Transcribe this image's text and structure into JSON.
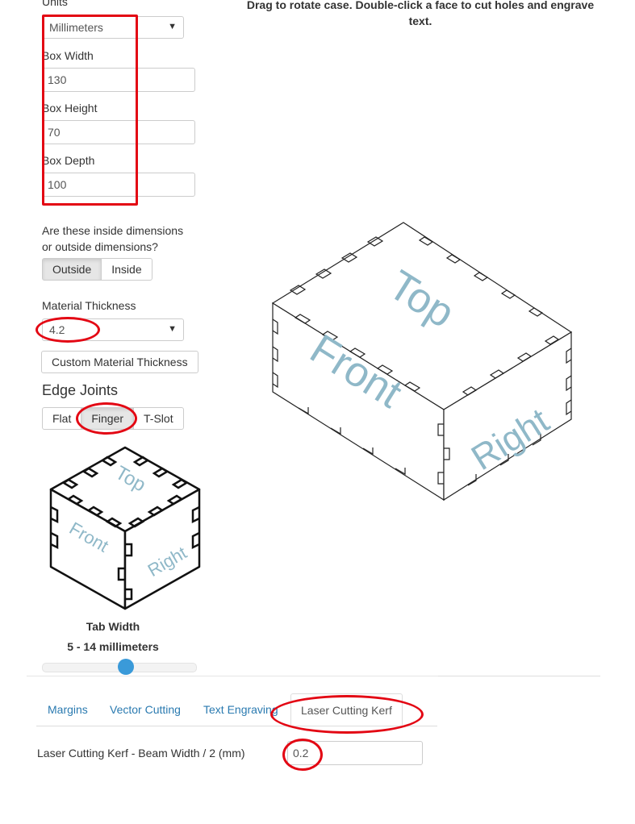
{
  "instructions": "Drag to rotate case. Double-click a face to cut holes and engrave text.",
  "units": {
    "label": "Units",
    "selected": "Millimeters"
  },
  "box_width": {
    "label": "Box Width",
    "value": "130"
  },
  "box_height": {
    "label": "Box Height",
    "value": "70"
  },
  "box_depth": {
    "label": "Box Depth",
    "value": "100"
  },
  "dimensions_question": {
    "line1": "Are these inside dimensions",
    "line2": "or outside dimensions?",
    "outside": "Outside",
    "inside": "Inside",
    "active": "Outside"
  },
  "material_thickness": {
    "label": "Material Thickness",
    "selected": "4.2",
    "custom_button": "Custom Material Thickness"
  },
  "edge_joints": {
    "heading": "Edge Joints",
    "flat": "Flat",
    "finger": "Finger",
    "tslot": "T-Slot",
    "active": "Finger"
  },
  "preview_faces": {
    "top": "Top",
    "front": "Front",
    "right": "Right"
  },
  "tab_width": {
    "label": "Tab Width",
    "range": "5 - 14 millimeters",
    "slider_fraction": 0.55
  },
  "settings_tabs": {
    "margins": "Margins",
    "vector_cutting": "Vector Cutting",
    "text_engraving": "Text Engraving",
    "laser_kerf": "Laser Cutting Kerf",
    "active": "Laser Cutting Kerf"
  },
  "kerf": {
    "label": "Laser Cutting Kerf - Beam Width / 2 (mm)",
    "value": "0.2"
  },
  "annotation_color": "#e30613",
  "face_text_color": "#8fb8c8"
}
